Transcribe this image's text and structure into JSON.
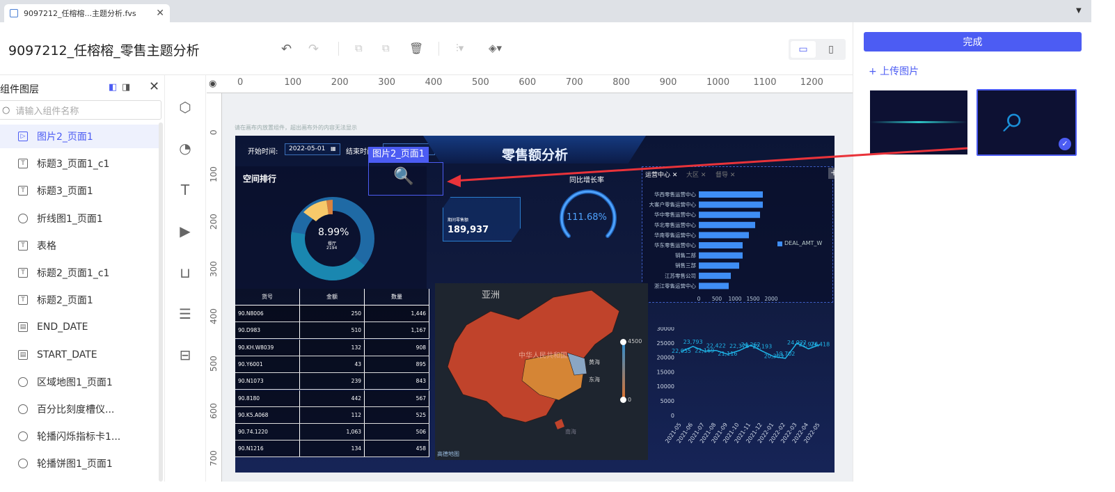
{
  "tab": {
    "title": "9097212_任榕榕...主题分析.fvs",
    "close": "✕"
  },
  "header": {
    "title": "9097212_任榕榕_零售主题分析"
  },
  "layers": {
    "title": "组件图层",
    "search_placeholder": "请输入组件名称",
    "items": [
      {
        "label": "图片2_页面1",
        "icon": "image-icon",
        "selected": true
      },
      {
        "label": "标题3_页面1_c1",
        "icon": "text-icon"
      },
      {
        "label": "标题3_页面1",
        "icon": "text-icon"
      },
      {
        "label": "折线图1_页面1",
        "icon": "chart-icon"
      },
      {
        "label": "表格",
        "icon": "text-icon"
      },
      {
        "label": "标题2_页面1_c1",
        "icon": "text-icon"
      },
      {
        "label": "标题2_页面1",
        "icon": "text-icon"
      },
      {
        "label": "END_DATE",
        "icon": "date-icon"
      },
      {
        "label": "START_DATE",
        "icon": "date-icon"
      },
      {
        "label": "区域地图1_页面1",
        "icon": "chart-icon"
      },
      {
        "label": "百分比刻度槽仪...",
        "icon": "chart-icon"
      },
      {
        "label": "轮播闪烁指标卡1...",
        "icon": "chart-icon"
      },
      {
        "label": "轮播饼图1_页面1",
        "icon": "chart-icon"
      }
    ]
  },
  "ruler": {
    "h": [
      "0",
      "100",
      "200",
      "300",
      "400",
      "500",
      "600",
      "700",
      "800",
      "900",
      "1000",
      "1100",
      "1200"
    ],
    "v": [
      "0",
      "100",
      "200",
      "300",
      "400",
      "500",
      "600",
      "700"
    ]
  },
  "canvas": {
    "hint": "请在画布内放置组件，超出画布外的内容无法显示",
    "selection_label": "图片2_页面1"
  },
  "dashboard": {
    "start_label": "开始时间:",
    "start_value": "2022-05-01",
    "end_label": "结束时间",
    "title": "零售额分析",
    "space_rank": "空间排行",
    "donut_pct": "8.99%",
    "donut_sub1": "餐厅",
    "donut_sub2": "2194",
    "kpi_label": "期间零售额",
    "kpi_value": "189,937",
    "growth_title": "同比增长率",
    "growth_value": "111.68%",
    "tabs": [
      "运营中心",
      "大区",
      "督导"
    ],
    "legend": "DEAL_AMT_W",
    "bar_cats": [
      "华西零售运营中心",
      "大客户零售运营中心",
      "华中零售运营中心",
      "华北零售运营中心",
      "华南零售运营中心",
      "华东零售运营中心",
      "销售二部",
      "销售三部",
      "江苏零售公司",
      "浙江零售运营中心"
    ],
    "bar_ticks": [
      "0",
      "500",
      "1000",
      "1500",
      "2000"
    ],
    "table_headers": [
      "货号",
      "金额",
      "数量"
    ],
    "table_rows": [
      [
        "90.N8006",
        "250",
        "1,446"
      ],
      [
        "90.D983",
        "510",
        "1,167"
      ],
      [
        "90.KH.W8039",
        "132",
        "908"
      ],
      [
        "90.Y6001",
        "43",
        "895"
      ],
      [
        "90.N1073",
        "239",
        "843"
      ],
      [
        "90.8180",
        "442",
        "567"
      ],
      [
        "90.K5.A068",
        "112",
        "525"
      ],
      [
        "90.74.1220",
        "1,063",
        "506"
      ],
      [
        "90.N1216",
        "134",
        "458"
      ]
    ],
    "map_title": "亚洲",
    "map_scale_max": "4500",
    "map_scale_min": "0",
    "map_label_china": "中华人民共和国",
    "map_label_sea1": "黄海",
    "map_label_sea2": "东海",
    "map_label_sea3": "南海",
    "map_footer": "高德地图",
    "line_yticks": [
      "30000",
      "25000",
      "20000",
      "15000",
      "10000",
      "5000",
      "0"
    ],
    "line_xticks": [
      "2021-05",
      "2021-06",
      "2021-07",
      "2021-08",
      "2021-09",
      "2021-10",
      "2021-11",
      "2021-12",
      "2022-01",
      "2022-02",
      "2022-03",
      "2022-04",
      "2022-05"
    ],
    "line_labels": [
      "22,055",
      "23,793",
      "22,169",
      "22,422",
      "21,116",
      "22,378",
      "24,262",
      "22,193",
      "20,303",
      "19,702",
      "24,922",
      "22,976",
      "24,418"
    ]
  },
  "right_panel": {
    "done": "完成",
    "upload": "+ 上传图片"
  },
  "colors": {
    "accent": "#4c5cf3",
    "dash_bg": "#0b1536",
    "bar": "#3f8ef5",
    "map_red": "#c0432b",
    "line": "#1fb5e8"
  }
}
